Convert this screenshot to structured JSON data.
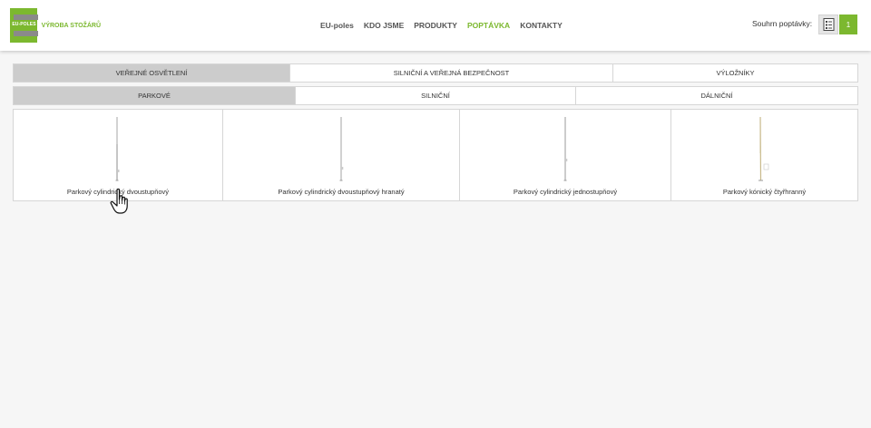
{
  "header": {
    "logo_text": "EU-POLES",
    "tagline": "VÝROBA STOŽÁRŮ",
    "nav": [
      {
        "label": "EU-poles",
        "active": false
      },
      {
        "label": "KDO JSME",
        "active": false
      },
      {
        "label": "PRODUKTY",
        "active": false
      },
      {
        "label": "POPTÁVKA",
        "active": true
      },
      {
        "label": "KONTAKTY",
        "active": false
      }
    ],
    "summary_label": "Souhrn poptávky:",
    "summary_icon": "inquiry-list-icon",
    "summary_count": "1"
  },
  "category_tabs": [
    {
      "label": "VEŘEJNÉ OSVĚTLENÍ",
      "active": true
    },
    {
      "label": "SILNIČNÍ A VEŘEJNÁ BEZPEČNOST",
      "active": false
    },
    {
      "label": "VÝLOŽNÍKY",
      "active": false
    }
  ],
  "subcategory_tabs": [
    {
      "label": "PARKOVÉ",
      "active": true
    },
    {
      "label": "SILNIČNÍ",
      "active": false
    },
    {
      "label": "DÁLNIČNÍ",
      "active": false
    }
  ],
  "products": [
    {
      "name": "Parkový cylindrický dvoustupňový",
      "image": "pole-image"
    },
    {
      "name": "Parkový cylindrický dvoustupňový hranatý",
      "image": "pole-image"
    },
    {
      "name": "Parkový cylindrický jednostupňový",
      "image": "pole-image"
    },
    {
      "name": "Parkový kónický čtyřhranný",
      "image": "pole-image"
    }
  ],
  "colors": {
    "accent": "#7cb82f",
    "active_tab": "#cccccc",
    "border": "#d6d6d6",
    "background": "#f6f6f6"
  }
}
